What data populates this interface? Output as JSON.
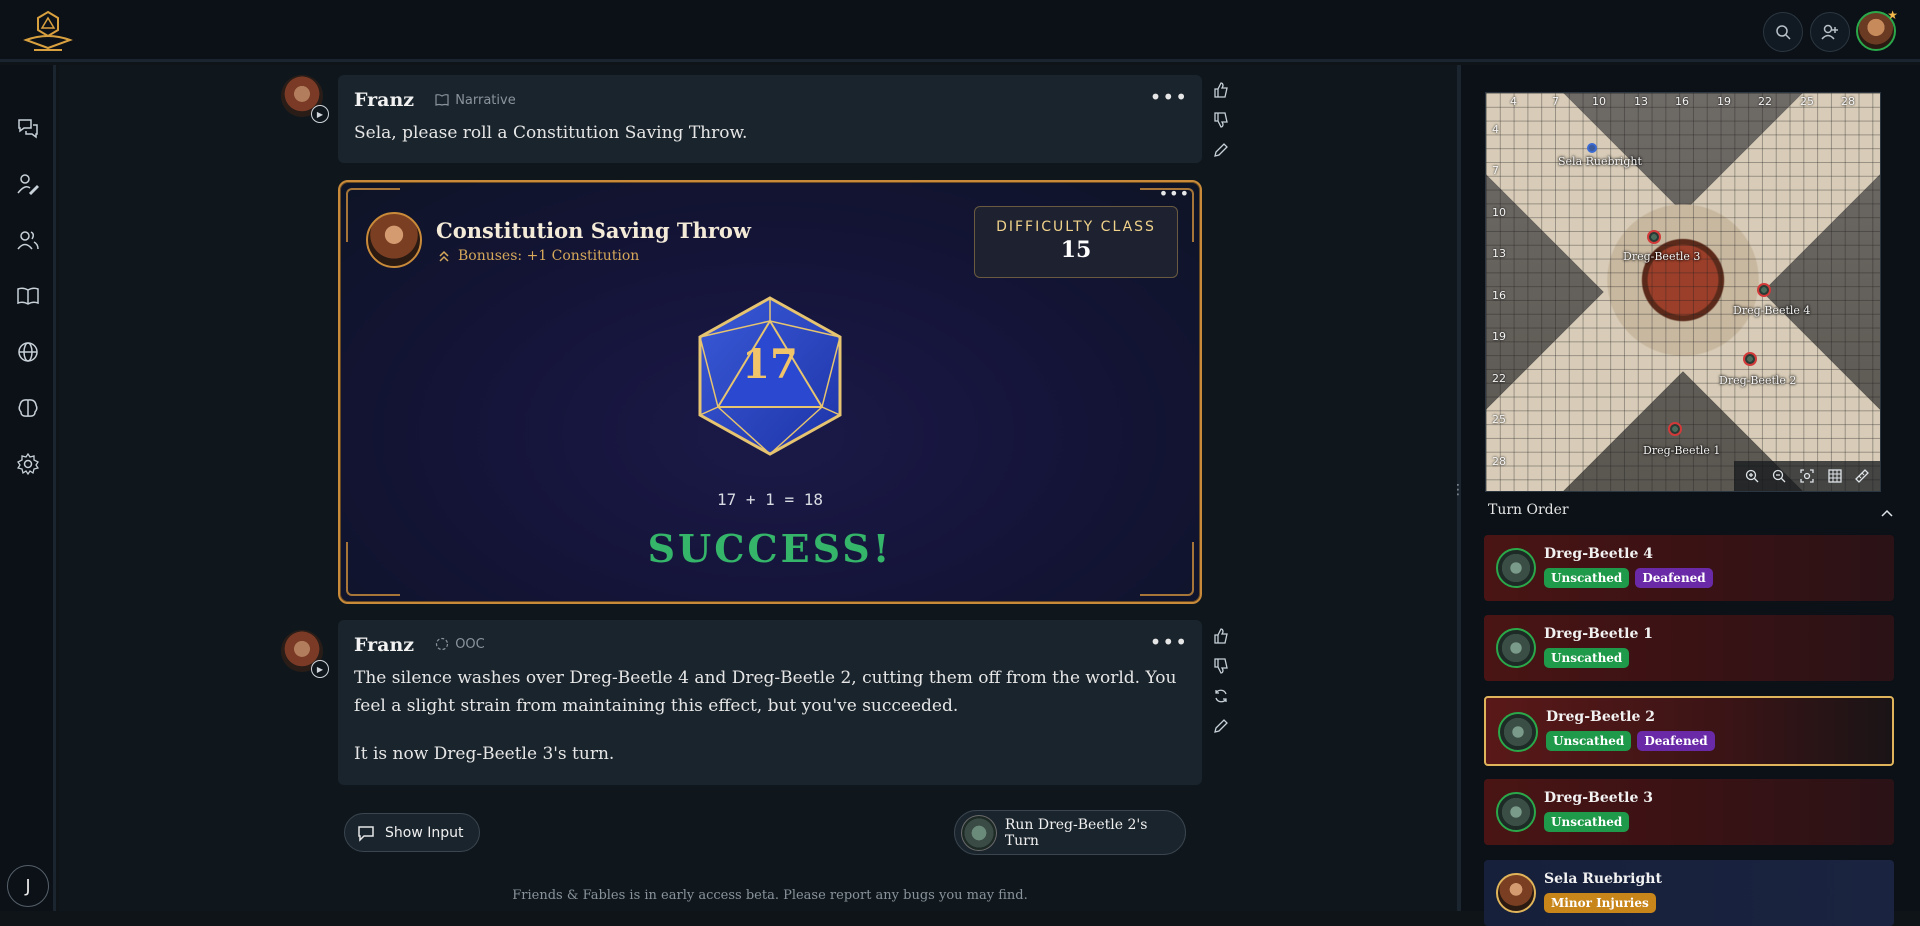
{
  "messages": [
    {
      "name": "Franz",
      "tag": "Narrative",
      "text": "Sela, please roll a Constitution Saving Throw."
    },
    {
      "name": "Franz",
      "tag": "OOC",
      "paragraph1": "The silence washes over Dreg-Beetle 4 and Dreg-Beetle 2, cutting them off from the world. You feel a slight strain from maintaining this effect, but you've succeeded.",
      "paragraph2": "It is now Dreg-Beetle 3's turn."
    }
  ],
  "roll": {
    "title": "Constitution Saving Throw",
    "bonus": "Bonuses: +1 Constitution",
    "dc_label": "DIFFICULTY CLASS",
    "dc_value": "15",
    "die_value": "17",
    "math": "17 + 1 = 18",
    "result": "SUCCESS!"
  },
  "actions": {
    "show_input": "Show Input",
    "run_turn": "Run Dreg-Beetle 2's Turn"
  },
  "footer": "Friends & Fables is in early access beta. Please report any bugs you may find.",
  "user_initial": "J",
  "map": {
    "col_labels": [
      "4",
      "7",
      "10",
      "13",
      "16",
      "19",
      "22",
      "25",
      "28"
    ],
    "row_labels": [
      "4",
      "7",
      "10",
      "13",
      "16",
      "19",
      "22",
      "25",
      "28"
    ],
    "tokens": [
      "Sela Ruebright",
      "Dreg-Beetle 3",
      "Dreg-Beetle 4",
      "Dreg-Beetle 2",
      "Dreg-Beetle 1"
    ]
  },
  "turn_order": {
    "title": "Turn Order",
    "entries": [
      {
        "name": "Dreg-Beetle 4",
        "badges": [
          "Unscathed",
          "Deafened"
        ]
      },
      {
        "name": "Dreg-Beetle 1",
        "badges": [
          "Unscathed"
        ]
      },
      {
        "name": "Dreg-Beetle 2",
        "badges": [
          "Unscathed",
          "Deafened"
        ]
      },
      {
        "name": "Dreg-Beetle 3",
        "badges": [
          "Unscathed"
        ]
      },
      {
        "name": "Sela Ruebright",
        "badges": [
          "Minor Injuries"
        ]
      }
    ]
  },
  "colors": {
    "accent_gold": "#c98a3a",
    "success_green": "#35b56a",
    "badge_green": "#1f9a4a",
    "badge_purple": "#6a2aa8",
    "badge_gold": "#c8851a"
  }
}
